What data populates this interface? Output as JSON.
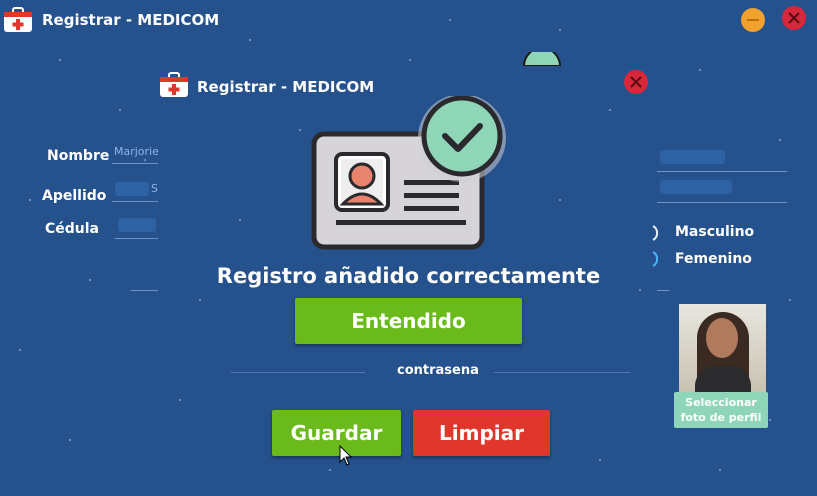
{
  "window": {
    "title": "Registrar - MEDICOM"
  },
  "dialog": {
    "title": "Registrar - MEDICOM",
    "message": "Registro añadido correctamente",
    "ok_label": "Entendido"
  },
  "form": {
    "nombre_label": "Nombre",
    "nombre_value": "Marjorie",
    "apellido_label": "Apellido",
    "apellido_value": "S",
    "cedula_label": "Cédula",
    "contrasena_label": "contrasena",
    "gender_options": [
      "Masculino",
      "Femenino"
    ]
  },
  "profile": {
    "select_photo_label": "Seleccionar foto de perfil"
  },
  "buttons": {
    "save_label": "Guardar",
    "clear_label": "Limpiar"
  },
  "colors": {
    "background": "#25518c",
    "green": "#6aba1c",
    "red": "#e0362c",
    "close_red": "#d6283a",
    "minimize_orange": "#f0a12e",
    "teal": "#8fd6b9"
  },
  "icons": [
    "medical-kit-icon",
    "minimize-icon",
    "close-icon",
    "id-card-icon",
    "check-badge-icon",
    "cursor-icon"
  ]
}
